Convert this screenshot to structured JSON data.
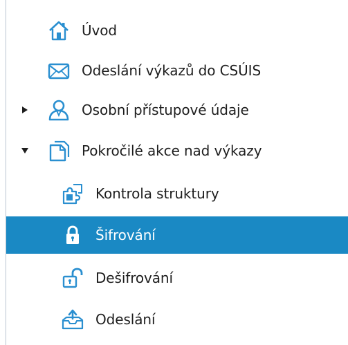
{
  "colors": {
    "selection": "#1a89c4",
    "icon_blue": "#2a8fd0",
    "text": "#1e1e1e"
  },
  "tree": {
    "items": [
      {
        "label": "Úvod",
        "icon": "home-icon",
        "level": 0,
        "expander": "none",
        "selected": false
      },
      {
        "label": "Odeslání výkazů do CSÚIS",
        "icon": "envelope-icon",
        "level": 0,
        "expander": "none",
        "selected": false
      },
      {
        "label": "Osobní přístupové údaje",
        "icon": "user-icon",
        "level": 0,
        "expander": "collapsed",
        "selected": false
      },
      {
        "label": "Pokročilé akce nad výkazy",
        "icon": "documents-icon",
        "level": 0,
        "expander": "expanded",
        "selected": false
      },
      {
        "label": "Kontrola struktury",
        "icon": "puzzle-icon",
        "level": 1,
        "expander": "none",
        "selected": false
      },
      {
        "label": "Šifrování",
        "icon": "lock-icon",
        "level": 1,
        "expander": "none",
        "selected": true
      },
      {
        "label": "Dešifrování",
        "icon": "unlock-icon",
        "level": 1,
        "expander": "none",
        "selected": false
      },
      {
        "label": "Odeslání",
        "icon": "send-tray-icon",
        "level": 1,
        "expander": "none",
        "selected": false
      }
    ]
  }
}
